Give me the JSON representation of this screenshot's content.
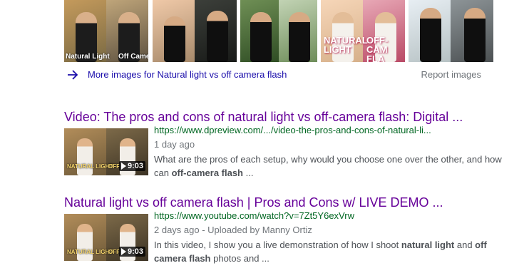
{
  "image_strip": {
    "thumbs": [
      {
        "caption_left": "Natural Light",
        "caption_right": "Off Camer"
      },
      {},
      {},
      {
        "overlay_left": [
          "NATURAL",
          "LIGHT"
        ],
        "overlay_right": [
          "OFF-CAM",
          "FLA"
        ]
      },
      {}
    ]
  },
  "more_images": {
    "icon": "arrow-right-icon",
    "label": "More images for Natural light vs off camera flash",
    "report_label": "Report images"
  },
  "results": [
    {
      "title": "Video: The pros and cons of natural light vs off-camera flash: Digital ...",
      "url": "https://www.dpreview.com/.../video-the-pros-and-cons-of-natural-li...",
      "meta": "1 day ago",
      "snippet_before": "What are the pros of each setup, why would you choose one over the other, and how can ",
      "snippet_bold": "off-camera flash",
      "snippet_after": " ...",
      "duration": "9:03",
      "thumb_text_left": "NATURAL LIGHT",
      "thumb_text_right": "OFF C"
    },
    {
      "title": "Natural light vs off camera flash | Pros and Cons w/ LIVE DEMO ...",
      "url": "https://www.youtube.com/watch?v=7Zt5Y6exVrw",
      "meta": "2 days ago - Uploaded by Manny Ortiz",
      "snippet_before": "In this video, I show you a live demonstration of how I shoot ",
      "snippet_bold": "natural light",
      "snippet_mid": " and ",
      "snippet_bold2": "off camera flash",
      "snippet_after": " photos and ...",
      "duration": "9:03",
      "thumb_text_left": "NATURAL LIGHT",
      "thumb_text_right": "OFF C"
    }
  ],
  "colors": {
    "title_visited": "#660099",
    "link": "#1a0dab",
    "url_green": "#006621",
    "meta_gray": "#70757a"
  }
}
